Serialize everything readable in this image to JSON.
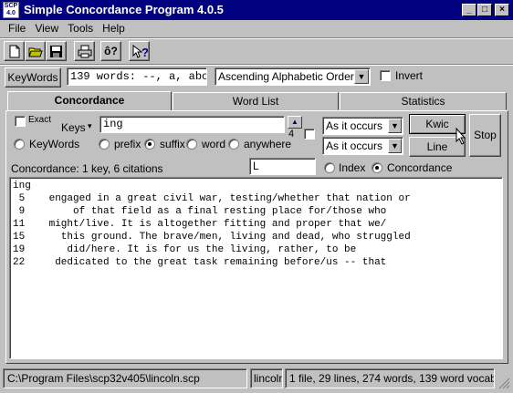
{
  "window": {
    "title": "Simple Concordance Program 4.0.5",
    "app_icon_text": "SCP 4.0",
    "minimize": "_",
    "maximize": "□",
    "close": "×"
  },
  "menu": [
    "File",
    "View",
    "Tools",
    "Help"
  ],
  "toolbar": {
    "icons": [
      "new-document-icon",
      "open-folder-icon",
      "save-disk-icon",
      "print-icon",
      "word-count-icon",
      "context-help-icon"
    ],
    "word_count_glyph": "ô?",
    "help_glyph": "?"
  },
  "wordbar": {
    "keywords_button": "KeyWords",
    "words_field": "139 words: --, a, abo",
    "order_select": "Ascending Alphabetic Order",
    "invert_label": "Invert",
    "invert_checked": false
  },
  "tabs": [
    "Concordance",
    "Word List",
    "Statistics"
  ],
  "active_tab": "Concordance",
  "concordance": {
    "exact_label": "Exact",
    "exact_checked": false,
    "keys_label": "Keys",
    "keys_arrow": "▾",
    "key_input": "ing",
    "spin_value": "4",
    "spin_up": "▲",
    "spin_checked": false,
    "sort1": "As it occurs",
    "sort2": "As it occurs",
    "kwic_button": "Kwic",
    "line_button": "Line",
    "stop_button": "Stop",
    "keywords_radio": "KeyWords",
    "prefix_radio": "prefix",
    "suffix_radio": "suffix",
    "word_radio": "word",
    "anywhere_radio": "anywhere",
    "selected_radio": "suffix",
    "summary": "Concordance:  1 key, 6 citations",
    "filter_value": "L",
    "index_radio": "Index",
    "concordance_radio": "Concordance",
    "view_selected": "Concordance",
    "results_header": "ing",
    "rows": [
      {
        "line": " 5",
        "text": "    engaged in a great civil war, testing/whether that nation or"
      },
      {
        "line": " 9",
        "text": "        of that field as a final resting place for/those who"
      },
      {
        "line": "11",
        "text": "    might/live. It is altogether fitting and proper that we/"
      },
      {
        "line": "15",
        "text": "      this ground. The brave/men, living and dead, who struggled"
      },
      {
        "line": "19",
        "text": "       did/here. It is for us the living, rather, to be"
      },
      {
        "line": "22",
        "text": "     dedicated to the great task remaining before/us -- that"
      }
    ]
  },
  "statusbar": {
    "path": "C:\\Program Files\\scp32v405\\lincoln.scp",
    "file": "lincoln",
    "info": "1 file, 29 lines, 274 words, 139 word vocabulary"
  }
}
